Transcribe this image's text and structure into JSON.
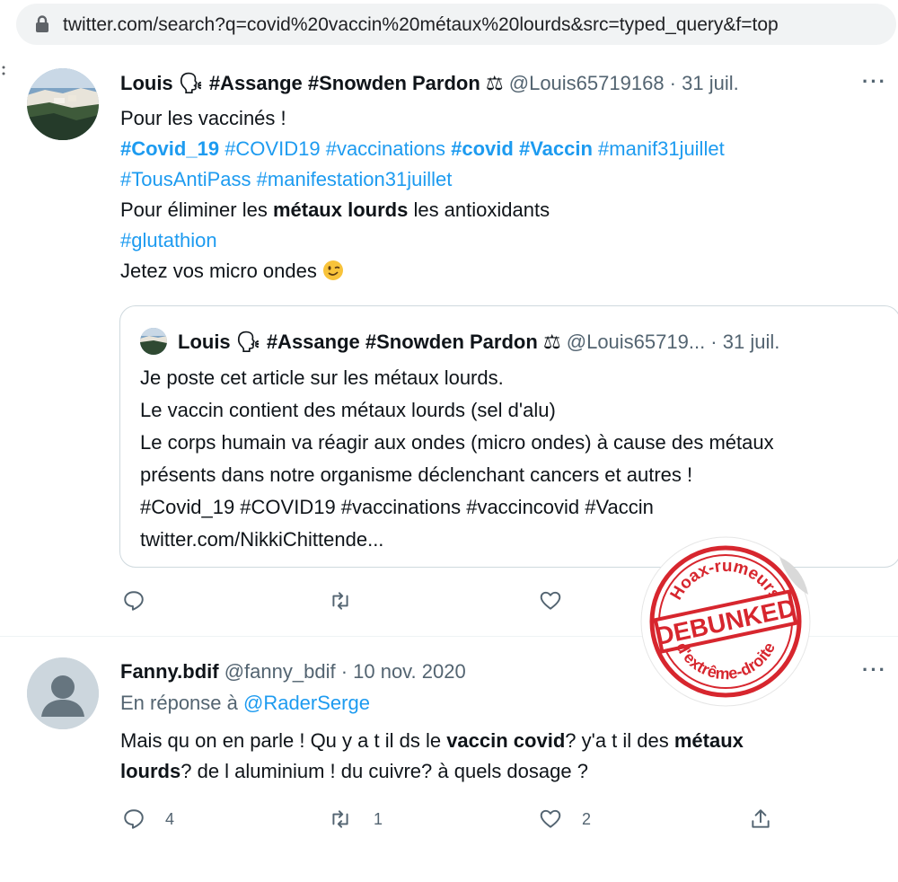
{
  "browser": {
    "url": "twitter.com/search?q=covid%20vaccin%20métaux%20lourds&src=typed_query&f=top"
  },
  "tweet1": {
    "name": "Louis 🗣 #Assange #Snowden Pardon ⚖",
    "handle": "@Louis65719168 · 31 juil.",
    "more": "···",
    "line1": "Pour les vaccinés !",
    "line2_tags": [
      "#Covid_19",
      "#COVID19",
      "#vaccinations",
      "#covid",
      "#Vaccin",
      "#manif31juillet"
    ],
    "line3_tags": [
      "#TousAntiPass",
      "#manifestation31juillet"
    ],
    "line4_pre": "Pour éliminer les ",
    "line4_bold": "métaux lourds",
    "line4_post": " les antioxidants",
    "line5_tag": "#glutathion",
    "line6": "Jetez vos micro ondes",
    "quote": {
      "name": "Louis 🗣 #Assange #Snowden Pardon ⚖",
      "handle": "@Louis65719... · 31 juil.",
      "lines": [
        "Je poste cet article sur les métaux lourds.",
        "Le vaccin contient des métaux lourds (sel d'alu)",
        "Le corps humain va réagir aux ondes (micro ondes) à cause des métaux",
        "présents dans notre organisme déclenchant cancers et autres !",
        "#Covid_19 #COVID19 #vaccinations #vaccincovid #Vaccin",
        "twitter.com/NikkiChittende..."
      ]
    }
  },
  "tweet2": {
    "name": "Fanny.bdif",
    "handle": "@fanny_bdif · 10 nov. 2020",
    "more": "···",
    "reply_prefix": "En réponse à ",
    "reply_handle": "@RaderSerge",
    "line1_a": "Mais qu on en parle ! Qu y a t il ds le ",
    "line1_b": "vaccin covid",
    "line1_c": "? y'a t il des ",
    "line1_d": "métaux",
    "line2_a": "lourds",
    "line2_b": "? de l aluminium ! du cuivre? à quels dosage ?",
    "replies": "4",
    "retweets": "1",
    "likes": "2"
  },
  "stamp": {
    "top_text": "Hoax-rumeurs",
    "main_text": "DEBUNKED",
    "bottom_text": "d'extrême-droite",
    "color": "#d7262e"
  }
}
